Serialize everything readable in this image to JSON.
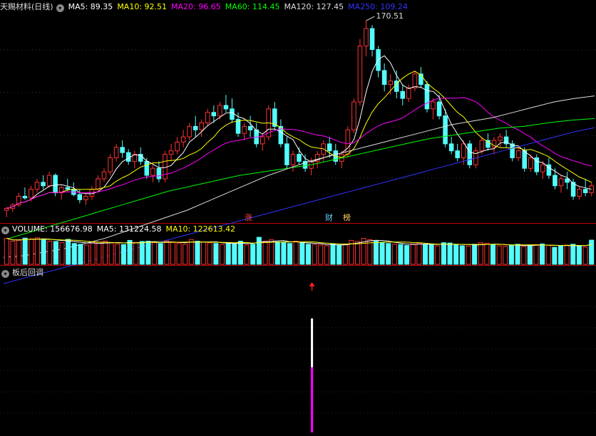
{
  "header": {
    "stock_title": "天赐材料(日线)",
    "ma": [
      {
        "label": "MA5: 89.35",
        "color": "#ffffff"
      },
      {
        "label": "MA10: 92.51",
        "color": "#ffff00"
      },
      {
        "label": "MA20: 96.65",
        "color": "#ff00ff"
      },
      {
        "label": "MA60: 114.45",
        "color": "#00ff00"
      },
      {
        "label": "MA120: 127.45",
        "color": "#dddddd"
      },
      {
        "label": "MA250: 109.24",
        "color": "#3333ff"
      }
    ]
  },
  "volume_header": {
    "volume_label": "VOLUME: 156676.98",
    "ma5_label": "MA5: 131224.58",
    "ma10_label": "MA10: 122613.42"
  },
  "indicator_header": {
    "name": "板后回调"
  },
  "annotations": {
    "peak_label": "170.51"
  },
  "events": [
    {
      "text": "涨",
      "color": "#ff4444"
    },
    {
      "text": "财",
      "color": "#66ccff"
    },
    {
      "text": "榜",
      "color": "#ffcc66"
    }
  ],
  "colors": {
    "up": "#ff3232",
    "down": "#54fcfc",
    "signal_top": "#ffffff",
    "signal_bottom": "#ff00ff",
    "arrow": "#ff2020"
  },
  "chart_data": {
    "type": "candlestick",
    "price": {
      "ylim": [
        60,
        175
      ],
      "candles": [
        [
          62,
          64,
          58,
          63
        ],
        [
          63,
          66,
          61,
          65
        ],
        [
          65,
          72,
          64,
          70
        ],
        [
          70,
          75,
          68,
          69
        ],
        [
          69,
          76,
          67,
          74
        ],
        [
          74,
          80,
          72,
          78
        ],
        [
          78,
          82,
          74,
          76
        ],
        [
          76,
          84,
          75,
          82
        ],
        [
          82,
          83,
          70,
          72
        ],
        [
          72,
          76,
          68,
          75
        ],
        [
          75,
          80,
          73,
          74
        ],
        [
          74,
          78,
          70,
          71
        ],
        [
          71,
          74,
          66,
          68
        ],
        [
          68,
          72,
          65,
          70
        ],
        [
          70,
          76,
          68,
          74
        ],
        [
          74,
          82,
          72,
          80
        ],
        [
          80,
          86,
          78,
          84
        ],
        [
          84,
          94,
          82,
          92
        ],
        [
          92,
          100,
          90,
          98
        ],
        [
          98,
          102,
          92,
          95
        ],
        [
          95,
          97,
          88,
          90
        ],
        [
          90,
          96,
          86,
          94
        ],
        [
          94,
          98,
          88,
          90
        ],
        [
          90,
          92,
          80,
          82
        ],
        [
          82,
          88,
          78,
          86
        ],
        [
          86,
          90,
          78,
          80
        ],
        [
          80,
          96,
          78,
          94
        ],
        [
          94,
          100,
          90,
          96
        ],
        [
          96,
          104,
          94,
          101
        ],
        [
          101,
          108,
          98,
          104
        ],
        [
          104,
          112,
          102,
          110
        ],
        [
          110,
          116,
          104,
          108
        ],
        [
          108,
          114,
          104,
          112
        ],
        [
          112,
          120,
          110,
          118
        ],
        [
          118,
          122,
          112,
          116
        ],
        [
          116,
          124,
          114,
          122
        ],
        [
          122,
          128,
          118,
          120
        ],
        [
          120,
          126,
          112,
          114
        ],
        [
          114,
          118,
          104,
          106
        ],
        [
          106,
          112,
          102,
          110
        ],
        [
          110,
          116,
          104,
          108
        ],
        [
          108,
          112,
          98,
          100
        ],
        [
          100,
          106,
          96,
          104
        ],
        [
          104,
          122,
          102,
          120
        ],
        [
          120,
          124,
          108,
          110
        ],
        [
          110,
          114,
          98,
          100
        ],
        [
          100,
          104,
          86,
          88
        ],
        [
          88,
          96,
          84,
          94
        ],
        [
          94,
          98,
          88,
          90
        ],
        [
          90,
          94,
          84,
          86
        ],
        [
          86,
          92,
          82,
          90
        ],
        [
          90,
          96,
          86,
          94
        ],
        [
          94,
          102,
          90,
          100
        ],
        [
          100,
          104,
          92,
          96
        ],
        [
          96,
          100,
          88,
          90
        ],
        [
          90,
          96,
          86,
          94
        ],
        [
          94,
          110,
          92,
          108
        ],
        [
          108,
          126,
          106,
          124
        ],
        [
          124,
          160,
          122,
          156
        ],
        [
          156,
          170.51,
          150,
          166
        ],
        [
          166,
          168,
          150,
          154
        ],
        [
          154,
          156,
          138,
          142
        ],
        [
          142,
          146,
          130,
          134
        ],
        [
          134,
          140,
          128,
          136
        ],
        [
          136,
          142,
          126,
          130
        ],
        [
          130,
          134,
          122,
          126
        ],
        [
          126,
          134,
          124,
          132
        ],
        [
          132,
          142,
          130,
          140
        ],
        [
          140,
          144,
          132,
          134
        ],
        [
          134,
          136,
          118,
          120
        ],
        [
          120,
          126,
          114,
          124
        ],
        [
          124,
          128,
          114,
          116
        ],
        [
          116,
          120,
          98,
          100
        ],
        [
          100,
          104,
          94,
          96
        ],
        [
          96,
          100,
          90,
          92
        ],
        [
          92,
          102,
          88,
          100
        ],
        [
          100,
          102,
          86,
          88
        ],
        [
          88,
          98,
          86,
          96
        ],
        [
          96,
          104,
          94,
          102
        ],
        [
          102,
          106,
          96,
          98
        ],
        [
          98,
          104,
          94,
          102
        ],
        [
          102,
          106,
          98,
          104
        ],
        [
          104,
          108,
          98,
          100
        ],
        [
          100,
          102,
          90,
          92
        ],
        [
          92,
          98,
          90,
          96
        ],
        [
          96,
          98,
          84,
          86
        ],
        [
          86,
          94,
          84,
          92
        ],
        [
          92,
          94,
          82,
          84
        ],
        [
          84,
          90,
          80,
          88
        ],
        [
          88,
          92,
          80,
          82
        ],
        [
          82,
          86,
          74,
          76
        ],
        [
          76,
          82,
          72,
          80
        ],
        [
          80,
          84,
          74,
          78
        ],
        [
          78,
          80,
          68,
          70
        ],
        [
          70,
          76,
          68,
          74
        ],
        [
          74,
          80,
          70,
          72
        ],
        [
          72,
          78,
          70,
          76
        ]
      ],
      "ma_series": [
        {
          "period": 5,
          "color": "#ffffff"
        },
        {
          "period": 10,
          "color": "#ffff00"
        },
        {
          "period": 20,
          "color": "#ff00ff"
        },
        {
          "period": 60,
          "color": "#00ff00",
          "values": [
            45,
            49,
            53,
            57,
            61,
            65,
            69,
            73,
            76,
            79,
            82,
            84,
            86,
            88,
            91,
            94,
            97,
            100,
            103,
            105,
            107,
            109,
            110,
            112,
            113.5,
            114.5
          ]
        },
        {
          "period": 120,
          "color": "#dddddd",
          "values": [
            35,
            36,
            38,
            40,
            43,
            46,
            50,
            54,
            58,
            62,
            67,
            72,
            77,
            82,
            86,
            90,
            93,
            96,
            99,
            102,
            105,
            108,
            111,
            113,
            115,
            118,
            121,
            124,
            126,
            127.45
          ]
        },
        {
          "period": 250,
          "color": "#3333ff",
          "values": [
            20,
            23,
            26,
            29,
            32,
            35,
            38,
            41,
            44,
            47,
            50,
            53,
            56,
            59,
            62,
            65,
            68,
            71,
            74,
            77,
            80,
            83,
            86,
            89,
            92,
            95,
            98,
            101,
            104,
            107,
            109.24
          ]
        }
      ]
    },
    "volume": {
      "ylim": [
        0,
        180000
      ],
      "values": [
        168000,
        150000,
        156000,
        170000,
        165000,
        172000,
        160000,
        150000,
        148000,
        140000,
        162000,
        135000,
        130000,
        125000,
        140000,
        145000,
        150000,
        138000,
        132000,
        128000,
        155000,
        142000,
        148000,
        150000,
        140000,
        135000,
        152000,
        145000,
        138000,
        130000,
        160000,
        150000,
        145000,
        140000,
        135000,
        128000,
        140000,
        132000,
        150000,
        126000,
        130000,
        175000,
        150000,
        160000,
        145000,
        140000,
        135000,
        150000,
        138000,
        130000,
        128000,
        125000,
        120000,
        132000,
        124000,
        130000,
        155000,
        148000,
        168000,
        160000,
        150000,
        140000,
        135000,
        130000,
        128000,
        122000,
        132000,
        138000,
        130000,
        126000,
        120000,
        140000,
        138000,
        125000,
        120000,
        118000,
        130000,
        140000,
        136000,
        128000,
        120000,
        118000,
        124000,
        130000,
        115000,
        122000,
        128000,
        132000,
        124000,
        110000,
        118000,
        124000,
        130000,
        120000,
        112000,
        156676.98
      ]
    },
    "signal": {
      "bar_index": 50,
      "top_ratio": 1.0,
      "split_ratio": 0.57
    }
  }
}
